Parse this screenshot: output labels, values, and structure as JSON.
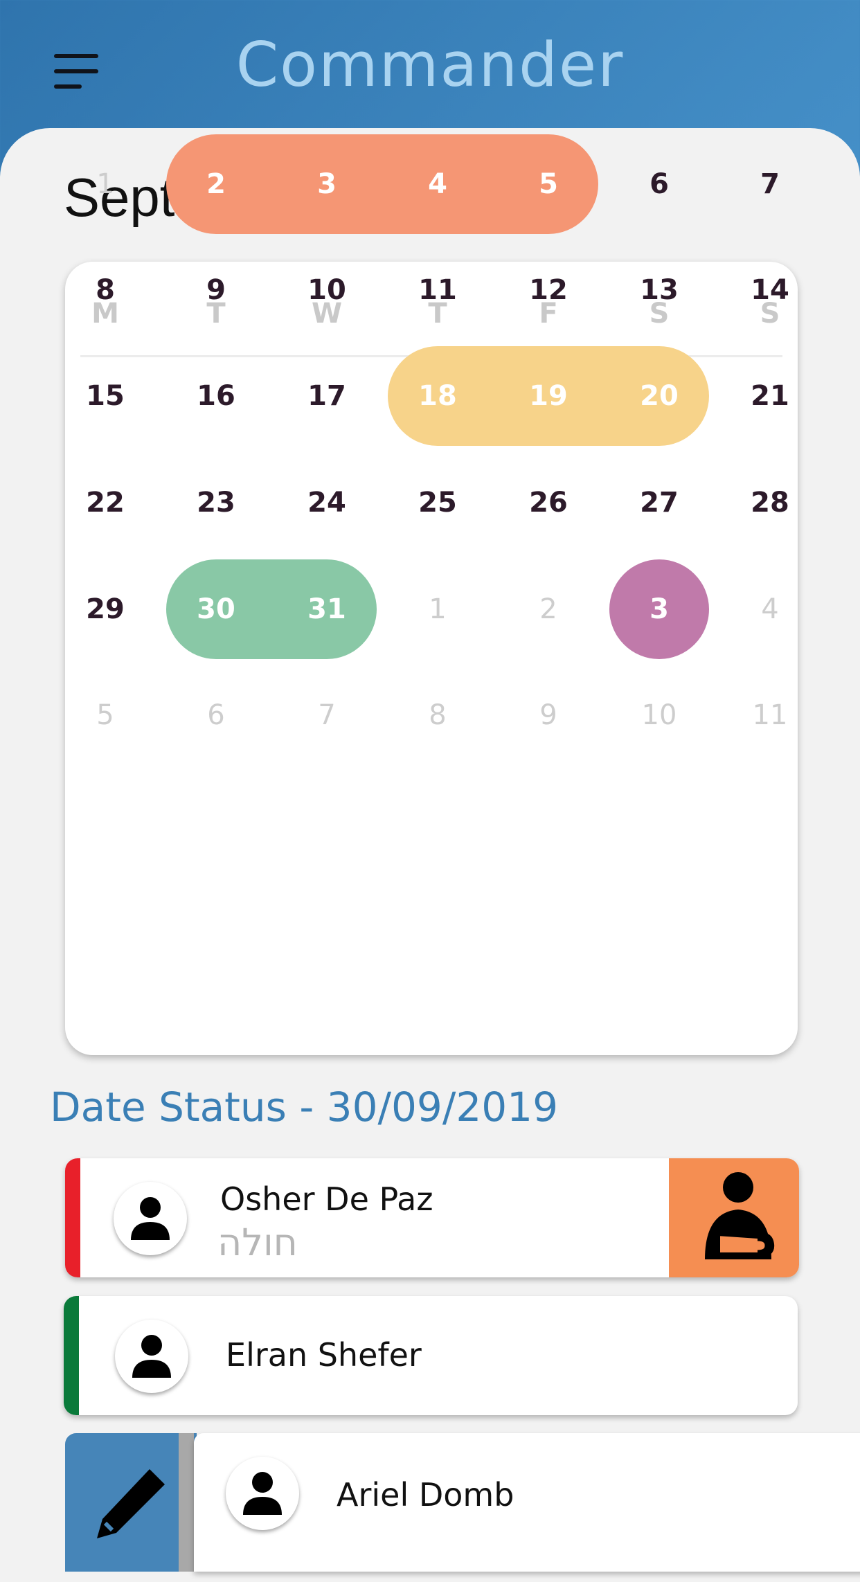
{
  "header": {
    "title": "Commander",
    "menu_icon": "hamburger-menu-icon"
  },
  "calendar": {
    "month": "September",
    "weekdays": [
      "M",
      "T",
      "W",
      "T",
      "F",
      "S",
      "S"
    ],
    "weeks": [
      [
        {
          "d": "1",
          "m": true
        },
        {
          "d": "2"
        },
        {
          "d": "3"
        },
        {
          "d": "4"
        },
        {
          "d": "5"
        },
        {
          "d": "6"
        },
        {
          "d": "7"
        }
      ],
      [
        {
          "d": "8"
        },
        {
          "d": "9"
        },
        {
          "d": "10"
        },
        {
          "d": "11"
        },
        {
          "d": "12"
        },
        {
          "d": "13"
        },
        {
          "d": "14"
        }
      ],
      [
        {
          "d": "15"
        },
        {
          "d": "16"
        },
        {
          "d": "17"
        },
        {
          "d": "18"
        },
        {
          "d": "19"
        },
        {
          "d": "20"
        },
        {
          "d": "21"
        }
      ],
      [
        {
          "d": "22"
        },
        {
          "d": "23"
        },
        {
          "d": "24"
        },
        {
          "d": "25"
        },
        {
          "d": "26"
        },
        {
          "d": "27"
        },
        {
          "d": "28"
        }
      ],
      [
        {
          "d": "29"
        },
        {
          "d": "30"
        },
        {
          "d": "31"
        },
        {
          "d": "1",
          "m": true
        },
        {
          "d": "2",
          "m": true
        },
        {
          "d": "3"
        },
        {
          "d": "4",
          "m": true
        }
      ],
      [
        {
          "d": "5",
          "m": true
        },
        {
          "d": "6",
          "m": true
        },
        {
          "d": "7",
          "m": true
        },
        {
          "d": "8",
          "m": true
        },
        {
          "d": "9",
          "m": true
        },
        {
          "d": "10",
          "m": true
        },
        {
          "d": "11",
          "m": true
        }
      ]
    ],
    "highlights": [
      {
        "row": 0,
        "from": 1,
        "to": 4,
        "color": "#f59674"
      },
      {
        "row": 2,
        "from": 3,
        "to": 5,
        "color": "#f7d38a"
      },
      {
        "row": 4,
        "from": 1,
        "to": 2,
        "color": "#89c8a6"
      },
      {
        "row": 4,
        "from": 5,
        "to": 5,
        "color": "#c07aaa"
      }
    ]
  },
  "date_status": {
    "title": "Date Status - 30/09/2019"
  },
  "people": [
    {
      "name": "Osher De Paz",
      "status": "חולה",
      "stripe": "#e8202a",
      "icon": "arm-sling-icon",
      "icon_bg": "#f58e52"
    },
    {
      "name": "Elran Shefer",
      "status": "",
      "stripe": "#0a7a3a"
    },
    {
      "name": "Ariel Domb",
      "status": "",
      "stripe": "#a8a8a8",
      "action_icon": "pencil-edit-icon",
      "action_bg": "#4685b8"
    }
  ]
}
